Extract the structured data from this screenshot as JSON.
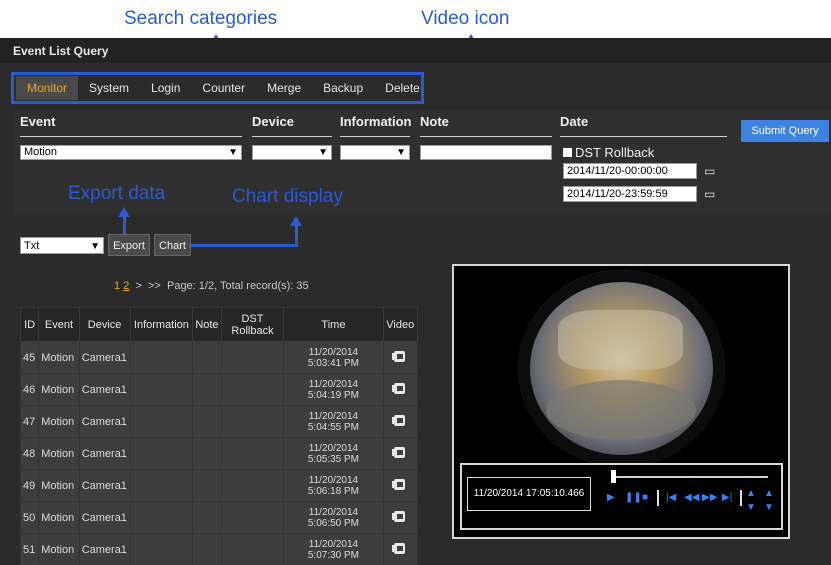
{
  "annotations": {
    "search_categories": "Search categories",
    "video_icon": "Video icon",
    "export_data": "Export data",
    "chart_display": "Chart display"
  },
  "window": {
    "title": "Event List Query"
  },
  "tabs": [
    {
      "label": "Monitor",
      "active": true
    },
    {
      "label": "System"
    },
    {
      "label": "Login"
    },
    {
      "label": "Counter"
    },
    {
      "label": "Merge"
    },
    {
      "label": "Backup"
    },
    {
      "label": "Delete"
    }
  ],
  "query": {
    "event_header": "Event",
    "device_header": "Device",
    "information_header": "Information",
    "note_header": "Note",
    "date_header": "Date",
    "event_value": "Motion",
    "device_value": "",
    "information_value": "",
    "note_value": "",
    "dst_label": "DST Rollback",
    "dst_checked": false,
    "date_from": "2014/11/20-00:00:00",
    "date_to": "2014/11/20-23:59:59",
    "submit_label": "Submit Query"
  },
  "export": {
    "format_value": "Txt",
    "export_label": "Export",
    "chart_label": "Chart"
  },
  "pager": {
    "page1": "1",
    "page2": "2",
    "next": ">",
    "last": ">>",
    "summary": "Page: 1/2, Total record(s): 35"
  },
  "table": {
    "headers": [
      "ID",
      "Event",
      "Device",
      "Information",
      "Note",
      "DST Rollback",
      "Time",
      "Video"
    ],
    "rows": [
      {
        "id": "45",
        "event": "Motion",
        "device": "Camera1",
        "date": "11/20/2014",
        "time": "5:03:41 PM"
      },
      {
        "id": "46",
        "event": "Motion",
        "device": "Camera1",
        "date": "11/20/2014",
        "time": "5:04:19 PM"
      },
      {
        "id": "47",
        "event": "Motion",
        "device": "Camera1",
        "date": "11/20/2014",
        "time": "5:04:55 PM"
      },
      {
        "id": "48",
        "event": "Motion",
        "device": "Camera1",
        "date": "11/20/2014",
        "time": "5:05:35 PM"
      },
      {
        "id": "49",
        "event": "Motion",
        "device": "Camera1",
        "date": "11/20/2014",
        "time": "5:06:18 PM"
      },
      {
        "id": "50",
        "event": "Motion",
        "device": "Camera1",
        "date": "11/20/2014",
        "time": "5:06:50 PM"
      },
      {
        "id": "51",
        "event": "Motion",
        "device": "Camera1",
        "date": "11/20/2014",
        "time": "5:07:30 PM"
      }
    ]
  },
  "player": {
    "timestamp": "11/20/2014 17:05:10.466",
    "icons": [
      "play-icon",
      "pause-icon",
      "stop-icon",
      "skip-start-icon",
      "rewind-icon",
      "fast-forward-icon",
      "skip-end-icon",
      "speed-up-icon",
      "speed-down-icon"
    ]
  },
  "colors": {
    "accent": "#2a5bd7",
    "active_tab": "#f0a41b",
    "submit": "#3d82e0",
    "control_icons": "#3a7ff0"
  }
}
